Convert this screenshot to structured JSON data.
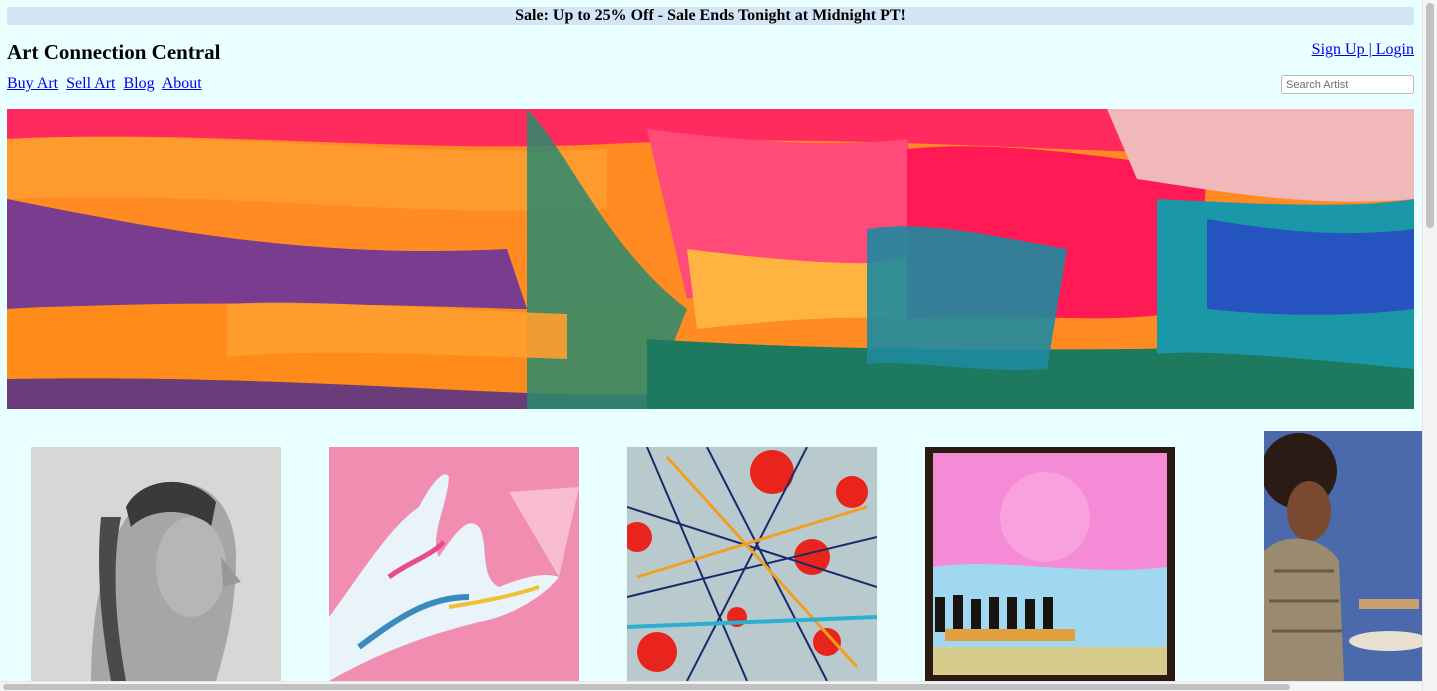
{
  "sale_banner": "Sale: Up to 25% Off - Sale Ends Tonight at Midnight PT!",
  "site_title": "Art Connection Central",
  "auth": {
    "signup_login": "Sign Up | Login"
  },
  "nav": {
    "items": [
      {
        "label": "Buy Art"
      },
      {
        "label": "Sell Art"
      },
      {
        "label": "Blog"
      },
      {
        "label": "About"
      }
    ]
  },
  "search": {
    "placeholder": "Search Artist",
    "value": ""
  },
  "colors": {
    "page_background": "#eaffff",
    "banner_background": "#d4e6f5",
    "link": "#0000ee"
  },
  "gallery": {
    "items": [
      {
        "subject": "pencil portrait of woman with braids"
      },
      {
        "subject": "colorful painted hand"
      },
      {
        "subject": "abstract splatter painting with red poppies"
      },
      {
        "subject": "pink abstract painting"
      },
      {
        "subject": "photo of artist holding palette"
      }
    ]
  }
}
